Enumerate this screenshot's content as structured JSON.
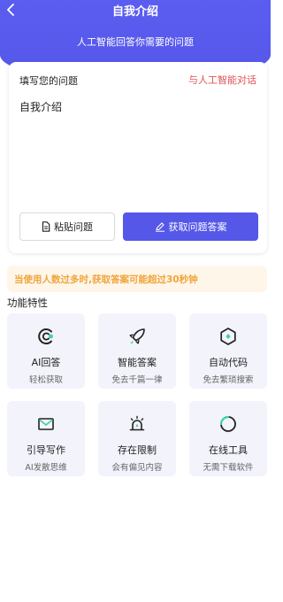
{
  "header": {
    "title": "自我介绍",
    "subtitle": "人工智能回答你需要的问题"
  },
  "card": {
    "label": "填写您的问题",
    "link": "与人工智能对话",
    "question_value": "自我介绍",
    "paste_label": "粘贴问题",
    "get_label": "获取问题答案"
  },
  "notice": "当使用人数过多时,获取答案可能超过30秒钟",
  "features": {
    "title": "功能特性",
    "items": [
      {
        "name": "AI回答",
        "desc": "轻松获取",
        "icon": "ai-c-icon"
      },
      {
        "name": "智能答案",
        "desc": "免去千篇一律",
        "icon": "rocket-icon"
      },
      {
        "name": "自动代码",
        "desc": "免去繁琐搜索",
        "icon": "hexagon-icon"
      },
      {
        "name": "引导写作",
        "desc": "AI发散思维",
        "icon": "mail-icon"
      },
      {
        "name": "存在限制",
        "desc": "会有偏见内容",
        "icon": "alarm-icon"
      },
      {
        "name": "在线工具",
        "desc": "无需下载软件",
        "icon": "circle-tool-icon"
      }
    ]
  },
  "colors": {
    "primary": "#5457e8",
    "link_red": "#e25252",
    "notice_text": "#f0a43a",
    "notice_bg": "#fff6ea",
    "accent_green": "#3ad29f",
    "tile_bg": "#f2f3fb"
  }
}
